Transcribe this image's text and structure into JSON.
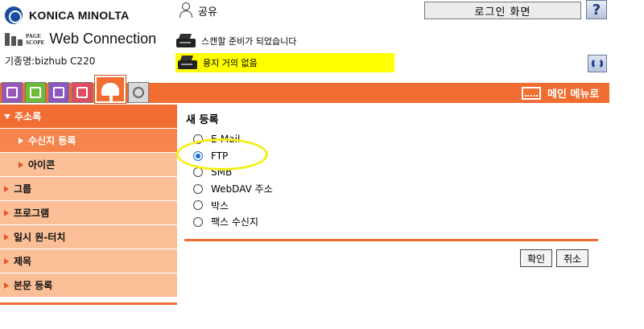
{
  "header": {
    "brand": "KONICA MINOLTA",
    "pagescope_mini": [
      "PAGE",
      "SCOPE"
    ],
    "product": "Web Connection",
    "model": "기종명:bizhub C220",
    "user_label": "공유",
    "login_button": "로그인 화면",
    "help_button": "?"
  },
  "status": {
    "scan_status": "스캔할 준비가 되었습니다",
    "print_status": "용지 거의 없음",
    "print_status_color": "#ffff00"
  },
  "tabbar": {
    "menu_label": "메인 메뉴로",
    "color": "#f16d32"
  },
  "sidebar": {
    "items": [
      {
        "label": "주소록"
      },
      {
        "label": "수신지 등록"
      },
      {
        "label": "아이콘"
      },
      {
        "label": "그룹"
      },
      {
        "label": "프로그램"
      },
      {
        "label": "일시 원-터치"
      },
      {
        "label": "제목"
      },
      {
        "label": "본문 등록"
      }
    ]
  },
  "main": {
    "section_title": "새 등록",
    "options": [
      {
        "label": "E-Mail"
      },
      {
        "label": "FTP"
      },
      {
        "label": "SMB"
      },
      {
        "label": "WebDAV 주소"
      },
      {
        "label": "박스"
      },
      {
        "label": "팩스 수신지"
      }
    ],
    "selected_option": "FTP",
    "ok_button": "확인",
    "cancel_button": "취소"
  }
}
